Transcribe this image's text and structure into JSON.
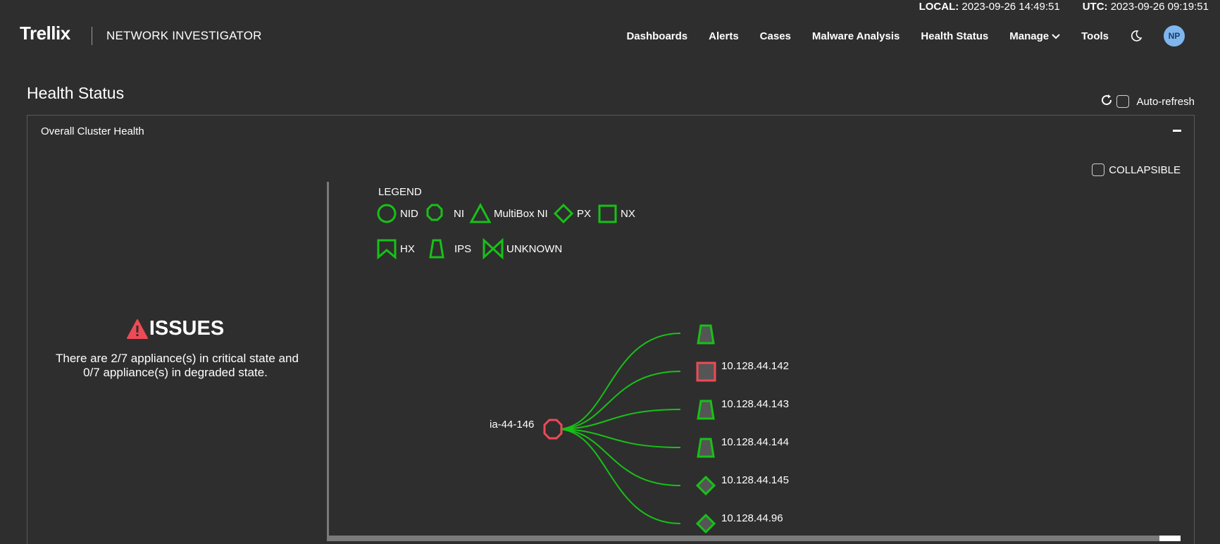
{
  "time": {
    "local_label": "LOCAL:",
    "local_value": "2023-09-26 14:49:51",
    "utc_label": "UTC:",
    "utc_value": "2023-09-26 09:19:51"
  },
  "header": {
    "brand": "Trellix",
    "product": "NETWORK INVESTIGATOR",
    "nav": [
      "Dashboards",
      "Alerts",
      "Cases",
      "Malware Analysis",
      "Health Status",
      "Manage",
      "Tools"
    ],
    "user_initials": "NP"
  },
  "page": {
    "title": "Health Status",
    "auto_refresh_label": "Auto-refresh"
  },
  "panel": {
    "title": "Overall Cluster Health",
    "collapsible_label": "COLLAPSIBLE"
  },
  "issues": {
    "heading": "ISSUES",
    "line1": "There are 2/7 appliance(s) in critical state and",
    "line2": "0/7 appliance(s) in degraded state."
  },
  "legend": {
    "title": "LEGEND",
    "items": [
      {
        "label": "NID",
        "shape": "circle"
      },
      {
        "label": "NI",
        "shape": "octagon"
      },
      {
        "label": "MultiBox NI",
        "shape": "triangle"
      },
      {
        "label": "PX",
        "shape": "diamond"
      },
      {
        "label": "NX",
        "shape": "square"
      },
      {
        "label": "HX",
        "shape": "bookmark"
      },
      {
        "label": "IPS",
        "shape": "trapezoid"
      },
      {
        "label": "UNKNOWN",
        "shape": "bowtie"
      }
    ]
  },
  "topology": {
    "root": {
      "label": "ia-44-146",
      "shape": "octagon",
      "status": "critical"
    },
    "children": [
      {
        "label": "",
        "shape": "trapezoid",
        "status": "ok"
      },
      {
        "label": "10.128.44.142",
        "shape": "square",
        "status": "critical"
      },
      {
        "label": "10.128.44.143",
        "shape": "trapezoid",
        "status": "ok"
      },
      {
        "label": "10.128.44.144",
        "shape": "trapezoid",
        "status": "ok"
      },
      {
        "label": "10.128.44.145",
        "shape": "diamond",
        "status": "ok"
      },
      {
        "label": "10.128.44.96",
        "shape": "diamond",
        "status": "ok"
      }
    ]
  },
  "colors": {
    "ok": "#17c117",
    "critical": "#ee4a55",
    "accent": "#00b5f0",
    "avatar": "#7fb6ee"
  }
}
